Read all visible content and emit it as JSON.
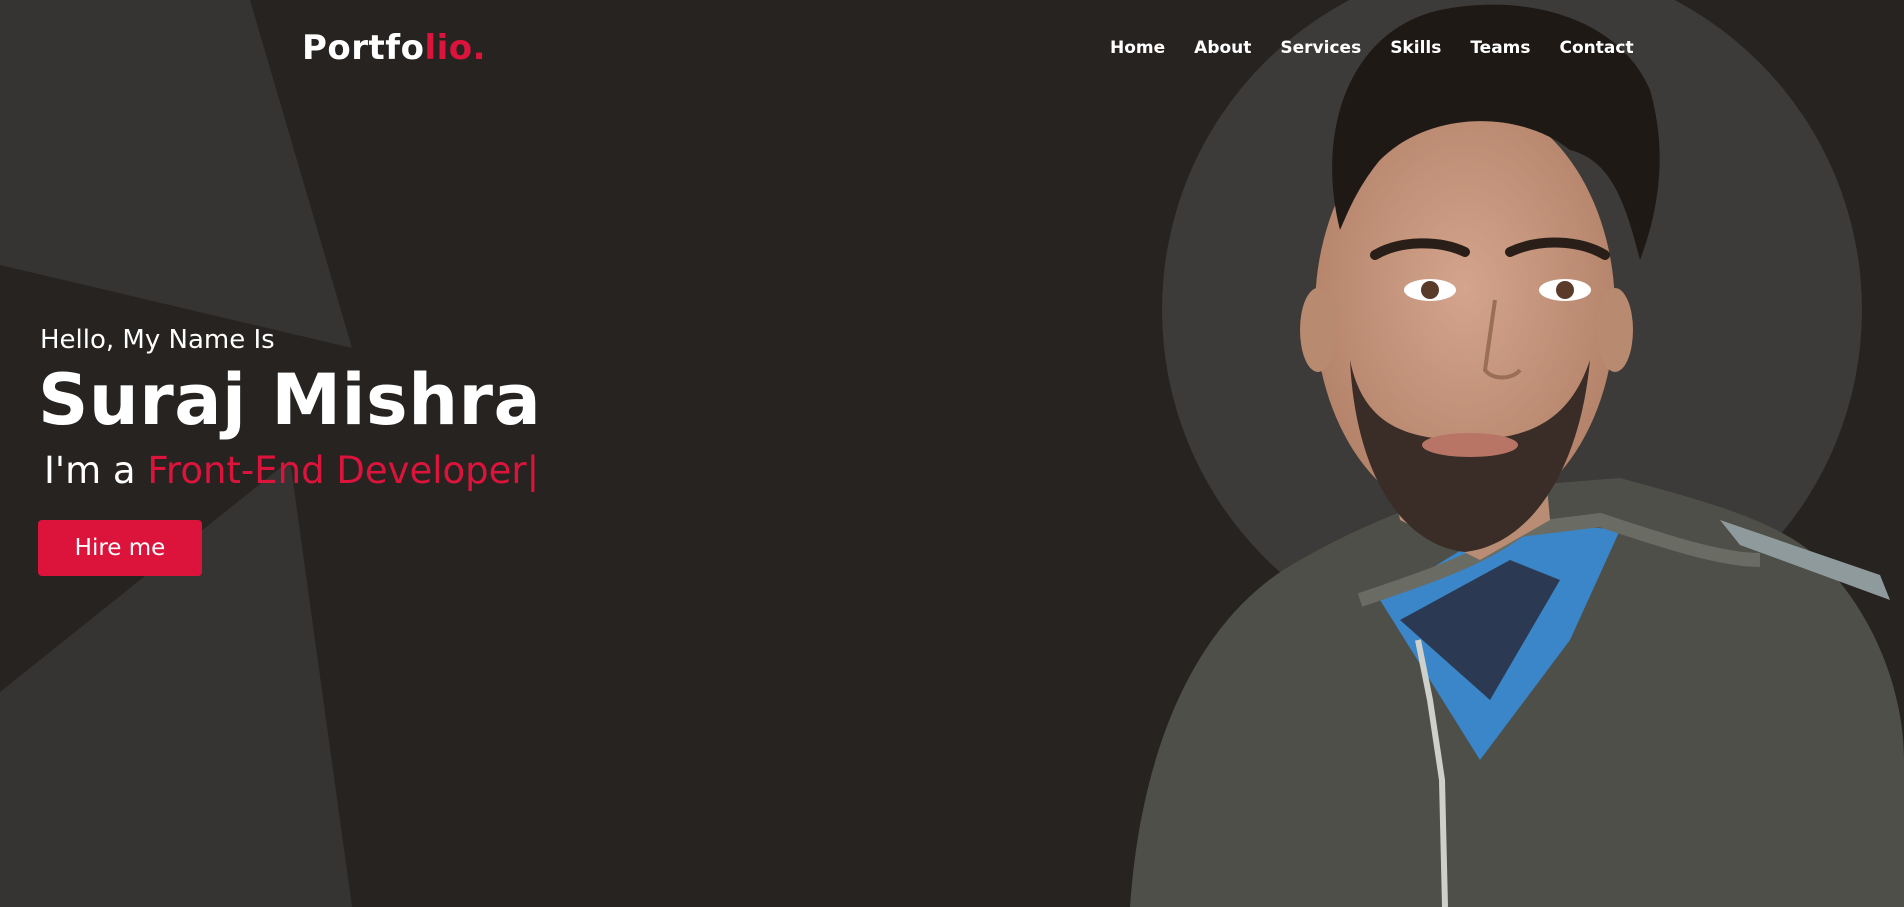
{
  "navbar": {
    "logo_main": "Portfo",
    "logo_accent": "lio.",
    "links": [
      "Home",
      "About",
      "Services",
      "Skills",
      "Teams",
      "Contact"
    ]
  },
  "hero": {
    "greeting": "Hello, My Name Is",
    "name": "Suraj Mishra",
    "role_prefix": "I'm a ",
    "role_typed": "Front-End Developer|",
    "cta_label": "Hire me"
  },
  "colors": {
    "background": "#262321",
    "accent": "#dc143c",
    "shape": "#363432",
    "circle": "#3c3b39"
  }
}
